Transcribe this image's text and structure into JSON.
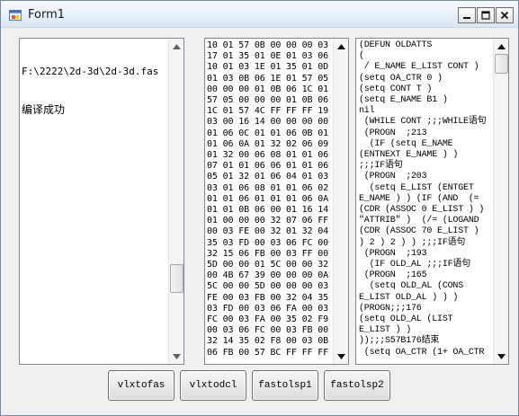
{
  "window": {
    "title": "Form1"
  },
  "left_text": {
    "lines": [
      "F:\\2222\\2d-3d\\2d-3d.fas",
      "编译成功"
    ],
    "scroll_position_fraction": 0.6
  },
  "hex_text": {
    "lines": [
      "10 01 57 0B 00 00 00 03",
      "17 01 35 01 0E 01 03 06",
      "10 01 03 1E 01 35 01 0D",
      "01 03 0B 06 1E 01 57 05",
      "00 00 00 01 0B 06 1C 01",
      "57 05 00 00 00 01 0B 06",
      "1C 01 57 4C FF FF FF 19",
      "03 00 16 14 00 00 00 00",
      "01 06 0C 01 01 06 0B 01",
      "01 06 0A 01 32 02 06 09",
      "01 32 00 06 08 01 01 06",
      "07 01 01 06 06 01 01 06",
      "05 01 32 01 06 04 01 03",
      "03 01 06 08 01 01 06 02",
      "01 01 06 01 01 01 06 0A",
      "01 01 0B 06 00 01 16 14",
      "01 00 00 00 32 07 06 FF",
      "00 03 FE 00 32 01 32 04",
      "35 03 FD 00 03 06 FC 00",
      "32 15 06 FB 00 03 FF 00",
      "5D 00 00 01 5C 00 00 32",
      "00 4B 67 39 00 00 00 0A",
      "5C 00 00 5D 00 00 00 03",
      "FE 00 03 FB 00 32 04 35",
      "03 FD 00 03 06 FA 00 03",
      "FC 00 03 FA 00 35 02 F9",
      "00 03 06 FC 00 03 FB 00",
      "32 14 35 02 F8 00 03 0B",
      "06 FB 00 57 BC FF FF FF"
    ]
  },
  "lisp_text": {
    "lines": [
      "(DEFUN OLDATTS",
      "(",
      " / E_NAME E_LIST CONT )",
      "(setq OA_CTR 0 )",
      "(setq CONT T )",
      "(setq E_NAME B1 )",
      "nil",
      " (WHILE CONT ;;;WHILE语句",
      " (PROGN  ;213",
      "  (IF (setq E_NAME",
      "(ENTNEXT E_NAME ) )",
      ";;;IF语句",
      " (PROGN  ;203",
      "  (setq E_LIST (ENTGET",
      "E_NAME ) ) (IF (AND  (=",
      "(CDR (ASSOC 0 E_LIST ) )",
      "\"ATTRIB\" )  (/= (LOGAND",
      "(CDR (ASSOC 70 E_LIST )",
      ") 2 ) 2 ) ) ;;;IF语句",
      " (PROGN  ;193",
      "  (IF OLD_AL ;;;IF语句",
      " (PROGN  ;165",
      "  (setq OLD_AL (CONS",
      "E_LIST OLD_AL ) ) )",
      "(PROGN;;;176",
      "(setq OLD_AL (LIST",
      "E_LIST ) )",
      "));;;S57B176结束",
      " (setq OA_CTR (1+ OA_CTR"
    ]
  },
  "buttons": {
    "vlxtofas": "vlxtofas",
    "vlxtodcl": "vlxtodcl",
    "fastolsp1": "fastolsp1",
    "fastolsp2": "fastolsp2"
  }
}
